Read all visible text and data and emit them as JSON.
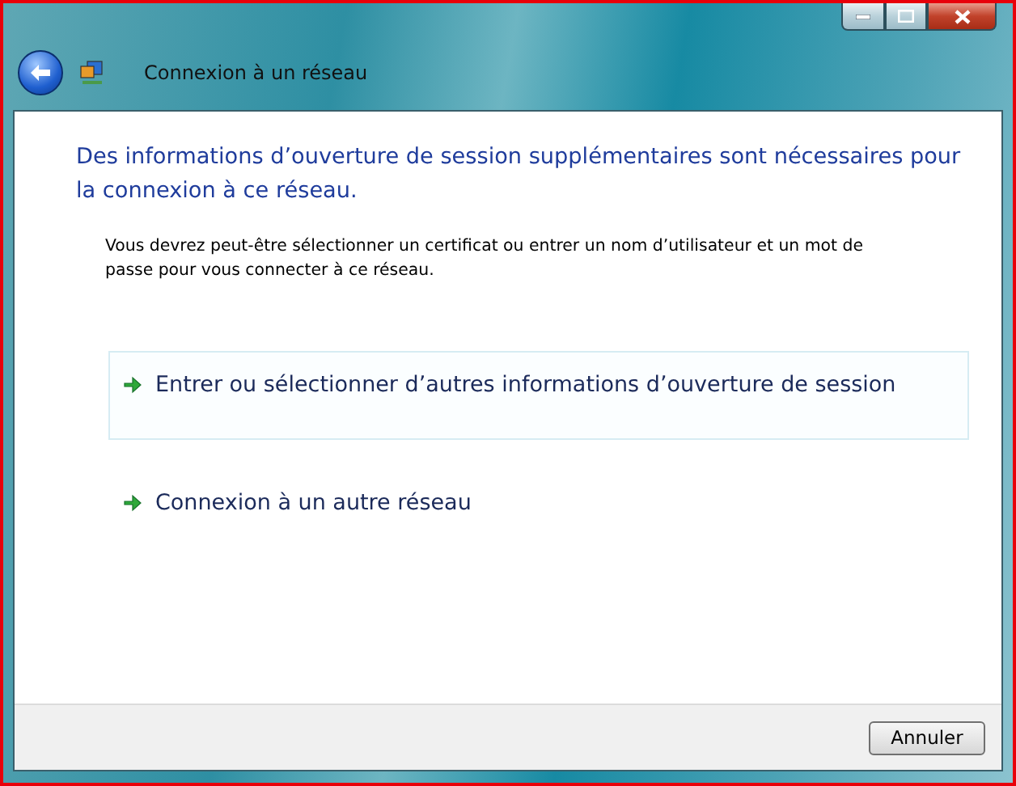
{
  "window": {
    "title": "Connexion à un réseau"
  },
  "heading": "Des informations d’ouverture de session supplémentaires sont nécessaires pour la connexion à ce réseau.",
  "description": "Vous devrez peut-être sélectionner un certificat ou entrer un nom d’utilisateur et un mot de passe pour vous connecter à ce réseau.",
  "options": [
    {
      "label": "Entrer ou sélectionner d’autres informations d’ouverture de session",
      "highlighted": true
    },
    {
      "label": "Connexion à un autre réseau",
      "highlighted": false
    }
  ],
  "buttons": [
    "Annuler"
  ]
}
